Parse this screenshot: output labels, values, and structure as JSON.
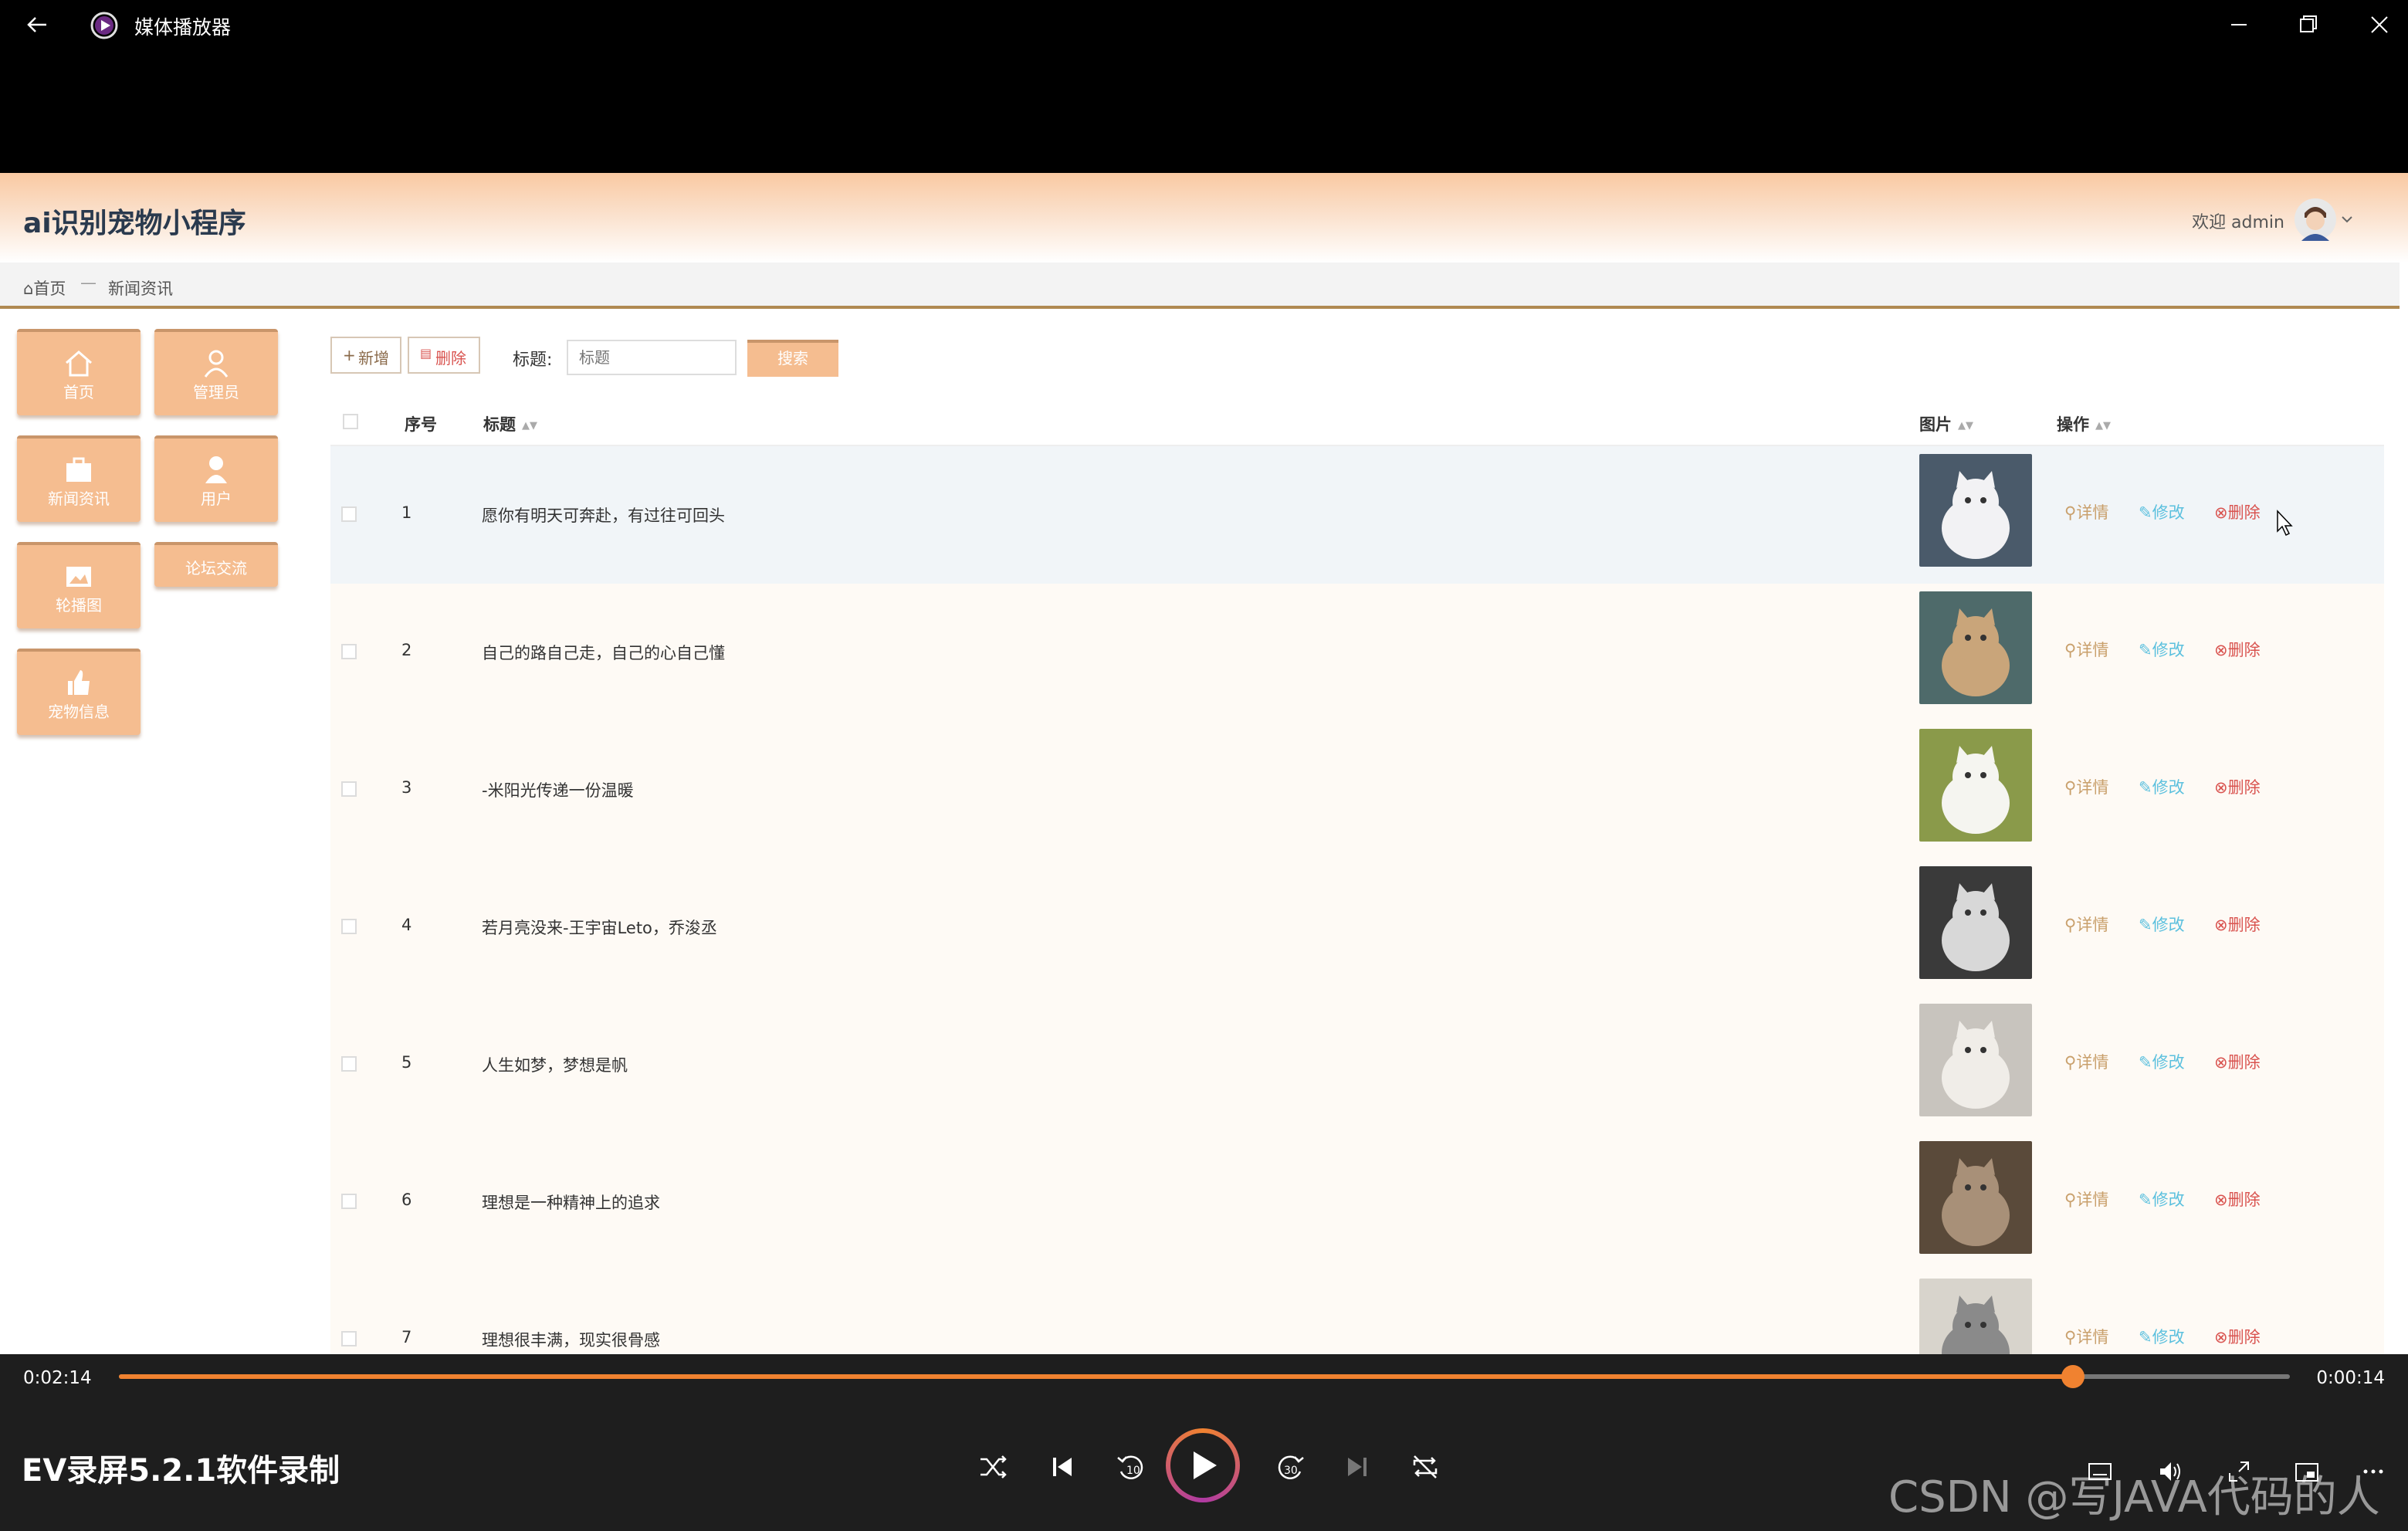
{
  "window": {
    "title": "媒体播放器"
  },
  "site": {
    "title": "ai识别宠物小程序",
    "welcome": "欢迎 admin",
    "breadcrumb": {
      "home": "首页",
      "separator": "—",
      "current": "新闻资讯"
    }
  },
  "sidebar": {
    "items": [
      {
        "label": "首页",
        "icon": "home-icon"
      },
      {
        "label": "管理员",
        "icon": "user-icon"
      },
      {
        "label": "新闻资讯",
        "icon": "briefcase-icon"
      },
      {
        "label": "用户",
        "icon": "person-icon"
      },
      {
        "label": "轮播图",
        "icon": "image-icon"
      },
      {
        "label": "论坛交流",
        "icon": ""
      },
      {
        "label": "宠物信息",
        "icon": "thumbs-up-icon"
      }
    ]
  },
  "toolbar": {
    "add_label": "新增",
    "delete_label": "删除",
    "title_label": "标题:",
    "title_placeholder": "标题",
    "search_label": "搜索"
  },
  "table": {
    "headers": {
      "index": "序号",
      "title": "标题",
      "image": "图片",
      "actions": "操作"
    },
    "rows": [
      {
        "index": "1",
        "title": "愿你有明天可奔赴，有过往可回头"
      },
      {
        "index": "2",
        "title": "自己的路自己走，自己的心自己懂"
      },
      {
        "index": "3",
        "title": "-米阳光传递一份温暖"
      },
      {
        "index": "4",
        "title": "若月亮没来-王宇宙Leto，乔浚丞"
      },
      {
        "index": "5",
        "title": "人生如梦，梦想是帆"
      },
      {
        "index": "6",
        "title": "理想是一种精神上的追求"
      },
      {
        "index": "7",
        "title": "理想很丰满，现实很骨感"
      }
    ],
    "actions": {
      "detail": "详情",
      "edit": "修改",
      "delete": "删除"
    }
  },
  "player": {
    "elapsed": "0:02:14",
    "total": "0:00:14",
    "progress": 0.9,
    "video_title": "EV录屏5.2.1软件录制",
    "watermark": "CSDN @写JAVA代码的人"
  },
  "colors": {
    "accent": "#f5bd90",
    "accent_border": "#c9956a",
    "progress": "#f08230",
    "edit_link": "#5bc0de",
    "delete_link": "#d9534f",
    "detail_link": "#c9a06c"
  }
}
